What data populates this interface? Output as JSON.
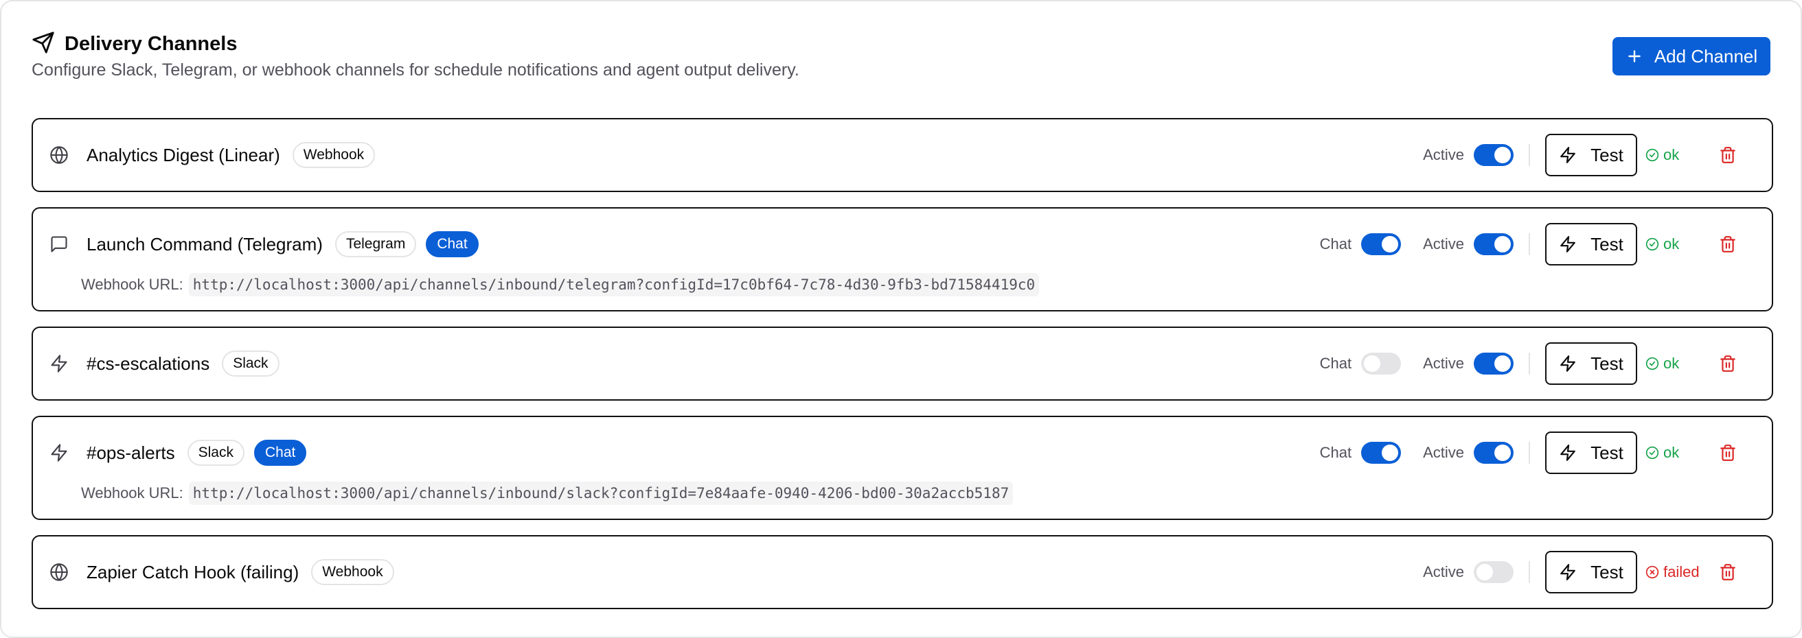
{
  "header": {
    "title": "Delivery Channels",
    "subtitle": "Configure Slack, Telegram, or webhook channels for schedule notifications and agent output delivery.",
    "add_button_label": "Add Channel"
  },
  "labels": {
    "chat": "Chat",
    "active": "Active",
    "test": "Test",
    "webhook_url": "Webhook URL:"
  },
  "channels": [
    {
      "name": "Analytics Digest (Linear)",
      "icon": "globe-icon",
      "type_badge": "Webhook",
      "chat_badge": null,
      "chat_toggle": null,
      "active": true,
      "status": "ok",
      "webhook_url": null
    },
    {
      "name": "Launch Command (Telegram)",
      "icon": "message-square-icon",
      "type_badge": "Telegram",
      "chat_badge": "Chat",
      "chat_toggle": true,
      "active": true,
      "status": "ok",
      "webhook_url": "http://localhost:3000/api/channels/inbound/telegram?configId=17c0bf64-7c78-4d30-9fb3-bd71584419c0"
    },
    {
      "name": "#cs-escalations",
      "icon": "zap-icon",
      "type_badge": "Slack",
      "chat_badge": null,
      "chat_toggle": false,
      "active": true,
      "status": "ok",
      "webhook_url": null
    },
    {
      "name": "#ops-alerts",
      "icon": "zap-icon",
      "type_badge": "Slack",
      "chat_badge": "Chat",
      "chat_toggle": true,
      "active": true,
      "status": "ok",
      "webhook_url": "http://localhost:3000/api/channels/inbound/slack?configId=7e84aafe-0940-4206-bd00-30a2accb5187"
    },
    {
      "name": "Zapier Catch Hook (failing)",
      "icon": "globe-icon",
      "type_badge": "Webhook",
      "chat_badge": null,
      "chat_toggle": null,
      "active": false,
      "status": "failed",
      "webhook_url": null
    }
  ],
  "colors": {
    "accent": "#0b5fd6",
    "ok": "#16a34a",
    "failed": "#dc2626",
    "toggle_off": "#e4e4e7"
  }
}
